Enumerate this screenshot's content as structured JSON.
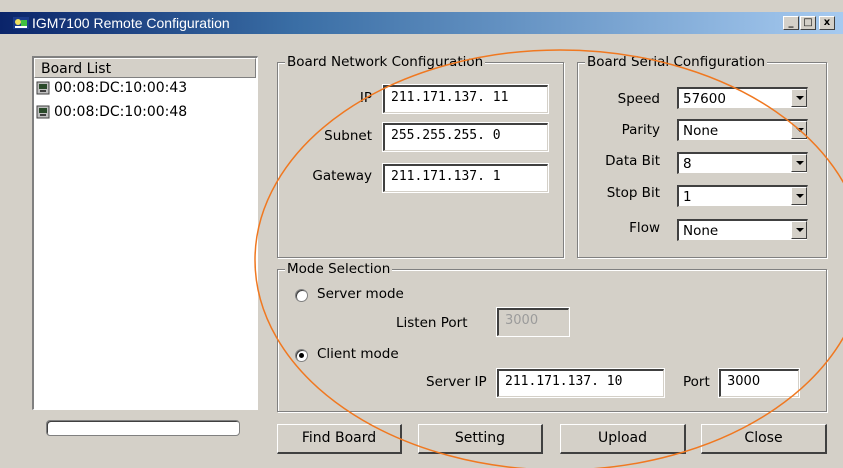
{
  "window": {
    "title": "IGM7100 Remote Configuration",
    "controls": {
      "minimize": "_",
      "maximize": "□",
      "close": "x"
    }
  },
  "board_list": {
    "header": "Board List",
    "items": [
      "00:08:DC:10:00:43",
      "00:08:DC:10:00:48"
    ],
    "progress_percent": 0
  },
  "network": {
    "legend": "Board Network Configuration",
    "ip_label": "IP",
    "ip_value": "211.171.137. 11",
    "subnet_label": "Subnet",
    "subnet_value": "255.255.255. 0",
    "gateway_label": "Gateway",
    "gateway_value": "211.171.137. 1"
  },
  "serial": {
    "legend": "Board Serial Configuration",
    "speed_label": "Speed",
    "speed_value": "57600",
    "parity_label": "Parity",
    "parity_value": "None",
    "databit_label": "Data Bit",
    "databit_value": "8",
    "stopbit_label": "Stop Bit",
    "stopbit_value": "1",
    "flow_label": "Flow",
    "flow_value": "None"
  },
  "mode": {
    "legend": "Mode Selection",
    "server_label": "Server mode",
    "listen_port_label": "Listen Port",
    "listen_port_value": "3000",
    "client_label": "Client mode",
    "server_ip_label": "Server IP",
    "server_ip_value": "211.171.137. 10",
    "port_label": "Port",
    "port_value": "3000",
    "selected": "client"
  },
  "buttons": {
    "find_board": "Find Board",
    "setting": "Setting",
    "upload": "Upload",
    "close": "Close"
  },
  "colors": {
    "face": "#d4d0c8",
    "title_start": "#0a246a",
    "title_end": "#a6caf0",
    "annotation_oval": "#f07820"
  }
}
